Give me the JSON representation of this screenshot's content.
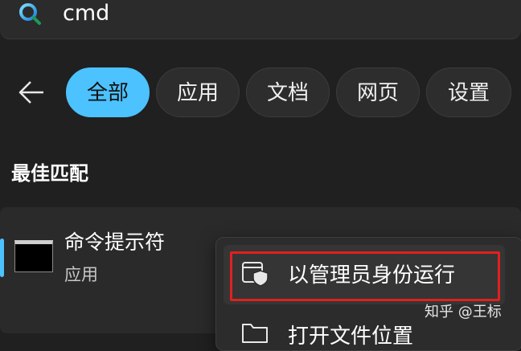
{
  "search": {
    "query": "cmd"
  },
  "filters": {
    "items": [
      {
        "label": "全部",
        "active": true
      },
      {
        "label": "应用",
        "active": false
      },
      {
        "label": "文档",
        "active": false
      },
      {
        "label": "网页",
        "active": false
      },
      {
        "label": "设置",
        "active": false
      }
    ]
  },
  "best_match": {
    "title": "最佳匹配",
    "app_name": "命令提示符",
    "app_type": "应用"
  },
  "context_menu": {
    "items": [
      {
        "label": "以管理员身份运行",
        "icon": "shield-window-icon"
      },
      {
        "label": "打开文件位置",
        "icon": "folder-icon"
      }
    ]
  },
  "watermark": "知乎 @王标",
  "colors": {
    "accent": "#4cc2ff",
    "highlight_frame": "#e02020",
    "background": "#202020"
  }
}
